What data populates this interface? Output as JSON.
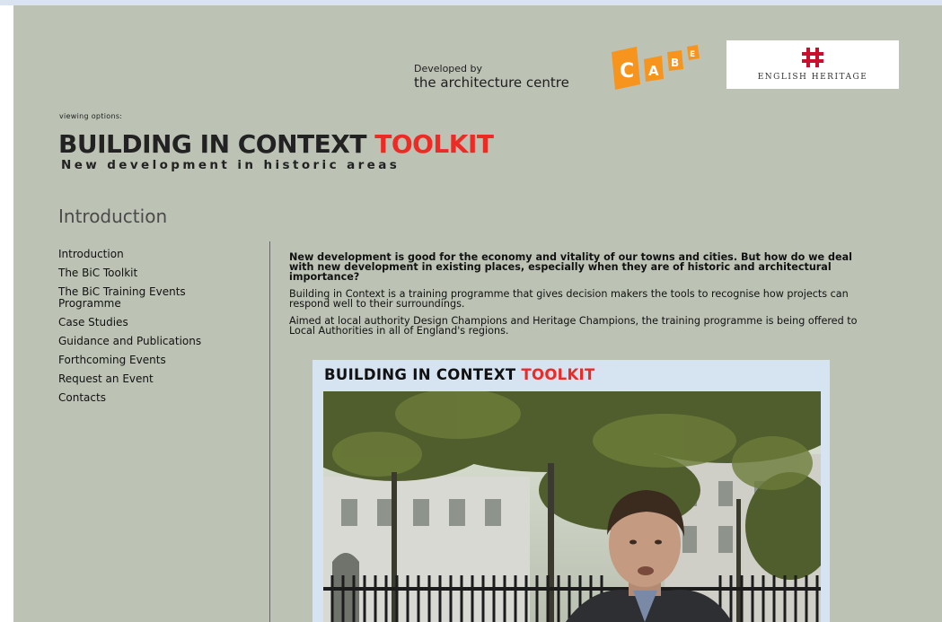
{
  "header": {
    "developed_by": "Developed by",
    "architecture_centre": "the architecture centre",
    "cabe_logo": {
      "letters": [
        "C",
        "A",
        "B",
        "E"
      ],
      "color": "#f7941d"
    },
    "english_heritage": "ENGLISH HERITAGE",
    "english_heritage_color": "#c8102e"
  },
  "viewing_options": "viewing options:",
  "title": {
    "main": "BUILDING IN CONTEXT ",
    "highlight": "TOOLKIT",
    "highlight_color": "#ee2a24"
  },
  "subtitle": "New development in historic areas",
  "section_title": "Introduction",
  "nav": {
    "items": [
      {
        "label": "Introduction"
      },
      {
        "label": "The BiC Toolkit"
      },
      {
        "label": "The BiC Training Events Programme"
      },
      {
        "label": "Case Studies"
      },
      {
        "label": "Guidance and Publications"
      },
      {
        "label": "Forthcoming Events"
      },
      {
        "label": "Request an Event"
      },
      {
        "label": "Contacts"
      }
    ]
  },
  "content": {
    "lead": "New development is good for the economy and vitality of our towns and cities. But how do we deal with new development in existing places, especially when they are of historic and architectural importance?",
    "p1": "Building in Context is a training programme that gives decision makers the tools to recognise how projects can respond well to their surroundings.",
    "p2": "Aimed at local authority Design Champions and Heritage Champions, the training programme is being offered to Local Authorities in all of England's regions."
  },
  "video": {
    "title_main": "BUILDING IN CONTEXT ",
    "title_highlight": "TOOLKIT"
  }
}
